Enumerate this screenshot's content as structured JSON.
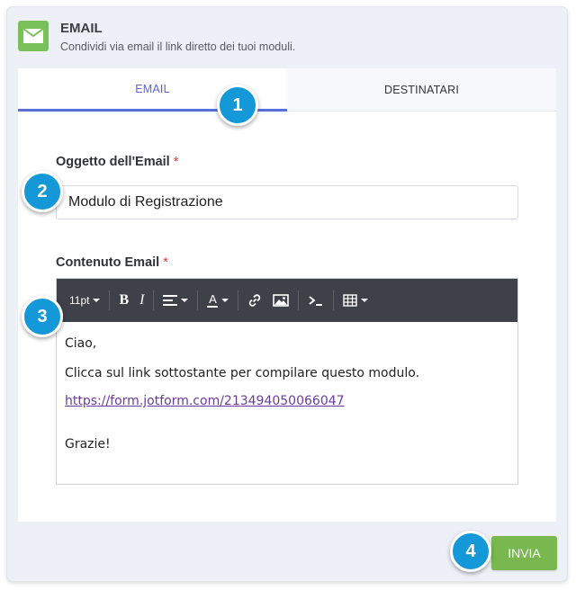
{
  "header": {
    "title": "EMAIL",
    "subtitle": "Condividi via email il link diretto dei tuoi moduli.",
    "icon": "envelope-icon",
    "icon_color": "#78c05a"
  },
  "tabs": [
    {
      "label": "EMAIL",
      "active": true
    },
    {
      "label": "DESTINATARI",
      "active": false
    }
  ],
  "subject": {
    "label": "Oggetto dell'Email",
    "required_mark": "*",
    "value": "Modulo di Registrazione"
  },
  "content": {
    "label": "Contenuto Email",
    "required_mark": "*",
    "toolbar": {
      "font_size": "11pt",
      "bold": "B",
      "italic": "I",
      "text_color": "A"
    },
    "body": {
      "greeting": "Ciao,",
      "instruction": "Clicca sul link sottostante per compilare questo modulo.",
      "link": "https://form.jotform.com/213494050066047",
      "closing": "Grazie!"
    }
  },
  "send_button": {
    "label": "INVIA",
    "color": "#78b84f"
  },
  "markers": [
    "1",
    "2",
    "3",
    "4"
  ],
  "colors": {
    "accent": "#5a6fd8",
    "marker": "#1598d8",
    "required": "#e23b3b"
  }
}
